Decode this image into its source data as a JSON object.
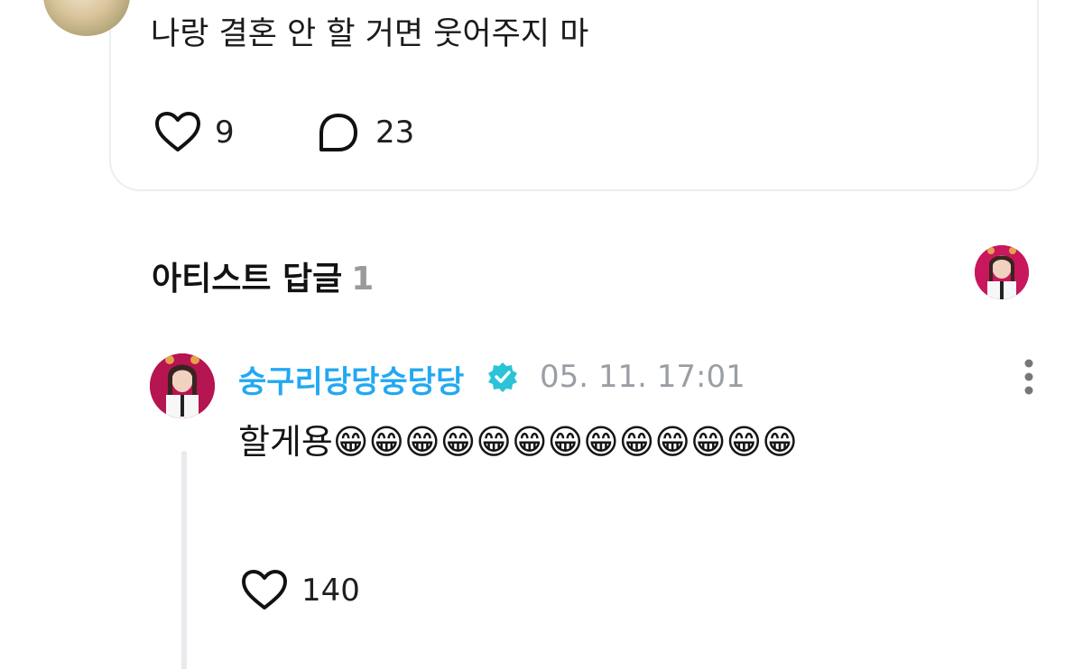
{
  "post": {
    "text": "나랑 결혼 안 할 거면 웃어주지 마",
    "like_count": "9",
    "comment_count": "23"
  },
  "artist_replies": {
    "title": "아티스트 답글",
    "count": "1"
  },
  "reply": {
    "author": "숭구리당당숭당당",
    "timestamp": "05. 11. 17:01",
    "text": "할게용😁😁😁😁😁😁😁😁😁😁😁😁😁",
    "like_count": "140"
  },
  "icons": {
    "like": "heart-outline-icon",
    "comment": "speech-bubble-icon",
    "verified": "verified-badge-icon",
    "more": "vertical-ellipsis-icon"
  },
  "colors": {
    "author_name": "#23a8f2",
    "verified_badge": "#2ac3d8",
    "timestamp": "#9a9ea5",
    "card_border": "#eceef1"
  }
}
